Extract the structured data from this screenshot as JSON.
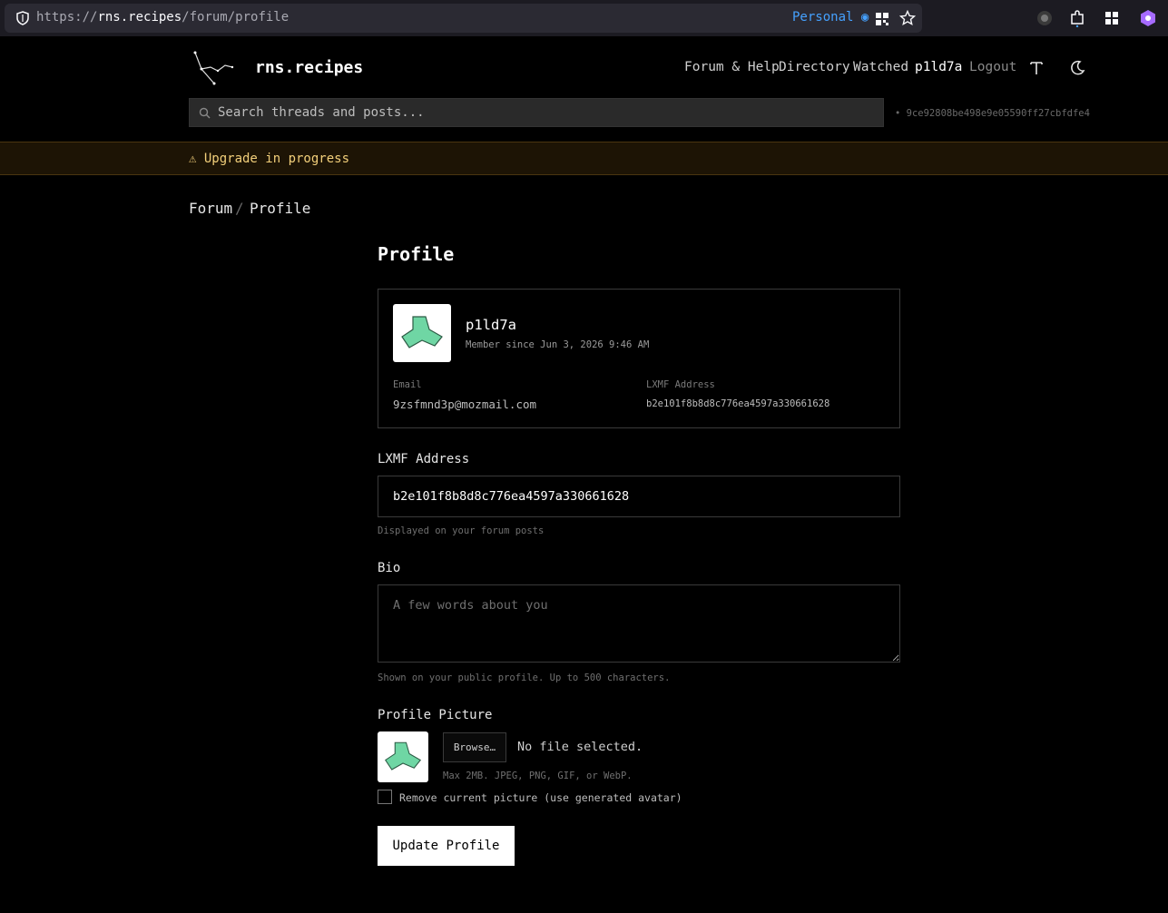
{
  "browser": {
    "url_scheme": "https://",
    "url_host": "rns.recipes",
    "url_path": "/forum/profile",
    "container_label": "Personal"
  },
  "site": {
    "name": "rns.recipes",
    "nav": [
      "Forum & Help",
      "Directory",
      "Watched",
      "p1ld7a",
      "Logout"
    ],
    "search_placeholder": "Search threads and posts...",
    "node_hash": "• 9ce92808be498e9e05590ff27cbfdfe4"
  },
  "banner": {
    "text": "⚠ Upgrade in progress"
  },
  "breadcrumb": {
    "forum": "Forum",
    "separator": "/",
    "current": "Profile"
  },
  "profile": {
    "title": "Profile",
    "username": "p1ld7a",
    "member_since": "Member since Jun 3, 2026 9:46 AM",
    "email_label": "Email",
    "email": "9zsfmnd3p@mozmail.com",
    "lxmf_label": "LXMF Address",
    "lxmf": "b2e101f8b8d8c776ea4597a330661628"
  },
  "form": {
    "lxmf_label": "LXMF Address",
    "lxmf_value": "b2e101f8b8d8c776ea4597a330661628",
    "lxmf_help": "Displayed on your forum posts",
    "bio_label": "Bio",
    "bio_placeholder": "A few words about you",
    "bio_help": "Shown on your public profile. Up to 500 characters.",
    "picture_label": "Profile Picture",
    "browse_label": "Browse…",
    "no_file": "No file selected.",
    "picture_help": "Max 2MB. JPEG, PNG, GIF, or WebP.",
    "remove_label": "Remove current picture (use generated avatar)",
    "submit_label": "Update Profile"
  },
  "colors": {
    "avatar_fill": "#6fd6a4",
    "banner_text": "#f2cf7a",
    "container_accent": "#45a1ff"
  }
}
